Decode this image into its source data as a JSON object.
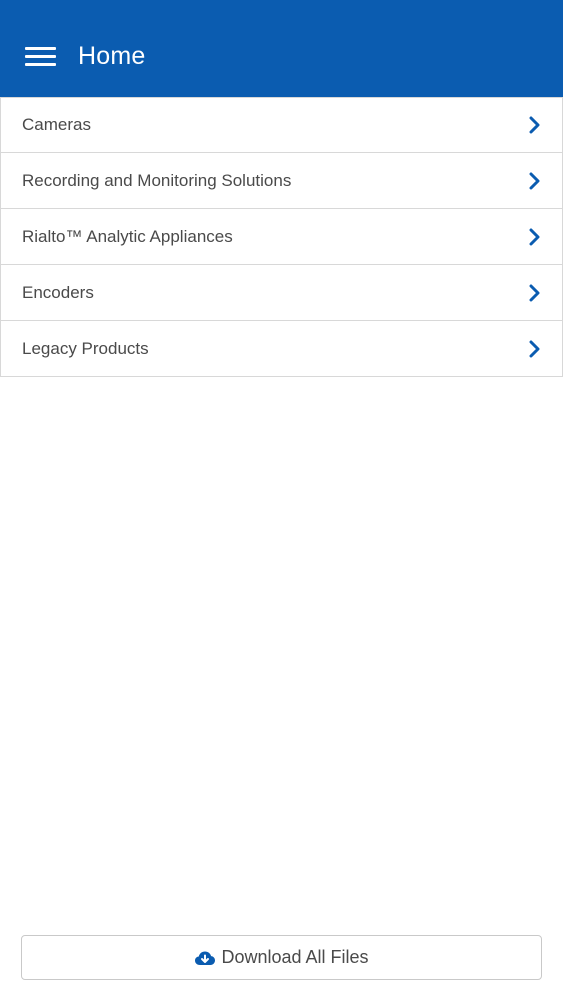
{
  "header": {
    "title": "Home",
    "menu_icon": "hamburger-menu-icon"
  },
  "categories": [
    {
      "label": "Cameras",
      "icon": "chevron-right-icon"
    },
    {
      "label": "Recording and Monitoring Solutions",
      "icon": "chevron-right-icon"
    },
    {
      "label": "Rialto™ Analytic Appliances",
      "icon": "chevron-right-icon"
    },
    {
      "label": "Encoders",
      "icon": "chevron-right-icon"
    },
    {
      "label": "Legacy Products",
      "icon": "chevron-right-icon"
    }
  ],
  "footer": {
    "download_label": "Download All Files",
    "download_icon": "cloud-download-icon"
  },
  "colors": {
    "header_bg": "#0b5cb0",
    "accent": "#0b5cb0",
    "text": "#4a4a4a",
    "divider": "#d8d8d8"
  }
}
